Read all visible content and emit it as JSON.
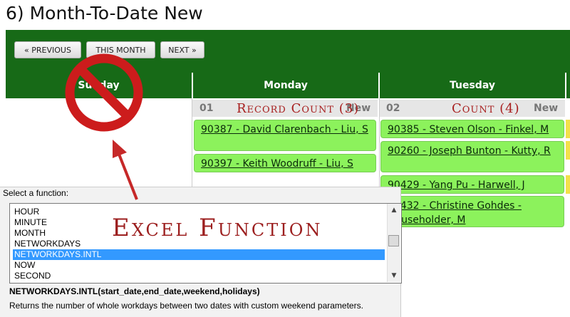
{
  "page": {
    "title": "6) Month-To-Date New"
  },
  "nav": {
    "previous": "« PREVIOUS",
    "this_month": "THIS MONTH",
    "next": "NEXT »"
  },
  "days": [
    {
      "label": "Sunday"
    },
    {
      "label": "Monday",
      "date": "01",
      "badge": "New",
      "note": "Record Count (3)",
      "records": [
        "90387 - David Clarenbach - Liu, S",
        "90397 - Keith Woodruff - Liu, S"
      ]
    },
    {
      "label": "Tuesday",
      "date": "02",
      "badge": "New",
      "note": "Count (4)",
      "records": [
        "90385 - Steven Olson - Finkel, M",
        "90260 - Joseph Bunton - Kutty, R",
        "90429 - Yang Pu - Harwell, J",
        "90432 - Christine Gohdes - Householder, M"
      ]
    }
  ],
  "excel": {
    "label": "Select a function:",
    "functions": [
      "HOUR",
      "MINUTE",
      "MONTH",
      "NETWORKDAYS",
      "NETWORKDAYS.INTL",
      "NOW",
      "SECOND"
    ],
    "selected": "NETWORKDAYS.INTL",
    "signature": "NETWORKDAYS.INTL(start_date,end_date,weekend,holidays)",
    "description": "Returns the number of whole workdays between two dates with custom weekend parameters.",
    "annotation": "Excel Function"
  },
  "colors": {
    "header_green": "#176a17",
    "record_green": "#8cf25c",
    "annotation_red": "#a82020",
    "selection_blue": "#3399ff"
  }
}
